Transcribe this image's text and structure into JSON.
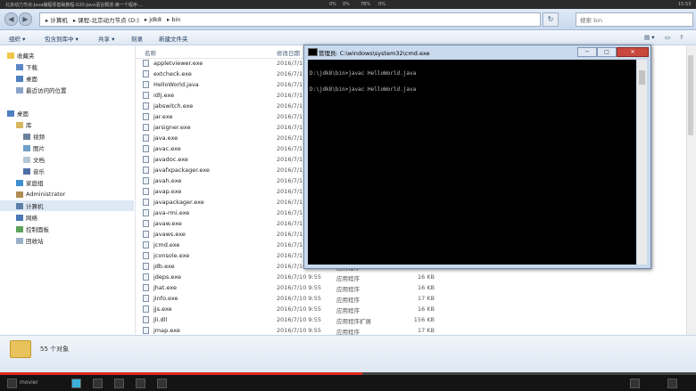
{
  "video_top": {
    "title": "北京动力节点-Java编程零基础教程-020-Java语言概述-第一个程序-...",
    "controls": [
      "0%",
      "0%",
      "78%",
      "0%"
    ],
    "time": "15:53"
  },
  "address": {
    "crumbs": [
      "▸ 计算机",
      "▸ 课程-北京动力节点 (D:)",
      "▸ jdk8",
      "▸ bin"
    ],
    "search_placeholder": "搜索 bin"
  },
  "toolbar": {
    "organize": "组织 ▾",
    "include": "包含到库中 ▾",
    "share": "共享 ▾",
    "burn": "刻录",
    "new_folder": "新建文件夹"
  },
  "nav": {
    "favorites": "收藏夹",
    "downloads": "下载",
    "desktop": "桌面",
    "recent": "最近访问的位置",
    "desktop2": "桌面",
    "library": "库",
    "videos": "视频",
    "pictures": "图片",
    "documents": "文档",
    "music": "音乐",
    "homegroup": "家庭组",
    "administrator": "Administrator",
    "computer": "计算机",
    "network": "网络",
    "control_panel": "控制面板",
    "recycle": "回收站"
  },
  "columns": {
    "name": "名称",
    "date": "修改日期"
  },
  "files": [
    {
      "name": "appletviewer.exe",
      "date": "2016/7/1",
      "type": "",
      "size": ""
    },
    {
      "name": "extcheck.exe",
      "date": "2016/7/1",
      "type": "",
      "size": ""
    },
    {
      "name": "HelloWorld.java",
      "date": "2016/7/1",
      "type": "",
      "size": ""
    },
    {
      "name": "idlj.exe",
      "date": "2016/7/1",
      "type": "",
      "size": ""
    },
    {
      "name": "jabswitch.exe",
      "date": "2016/7/1",
      "type": "",
      "size": ""
    },
    {
      "name": "jar.exe",
      "date": "2016/7/1",
      "type": "",
      "size": ""
    },
    {
      "name": "jarsigner.exe",
      "date": "2016/7/1",
      "type": "",
      "size": ""
    },
    {
      "name": "java.exe",
      "date": "2016/7/1",
      "type": "",
      "size": ""
    },
    {
      "name": "javac.exe",
      "date": "2016/7/1",
      "type": "",
      "size": ""
    },
    {
      "name": "javadoc.exe",
      "date": "2016/7/1",
      "type": "",
      "size": ""
    },
    {
      "name": "javafxpackager.exe",
      "date": "2016/7/1",
      "type": "",
      "size": ""
    },
    {
      "name": "javah.exe",
      "date": "2016/7/1",
      "type": "",
      "size": ""
    },
    {
      "name": "javap.exe",
      "date": "2016/7/1",
      "type": "",
      "size": ""
    },
    {
      "name": "javapackager.exe",
      "date": "2016/7/1",
      "type": "",
      "size": ""
    },
    {
      "name": "java-rmi.exe",
      "date": "2016/7/1",
      "type": "",
      "size": ""
    },
    {
      "name": "javaw.exe",
      "date": "2016/7/1",
      "type": "",
      "size": ""
    },
    {
      "name": "javaws.exe",
      "date": "2016/7/1",
      "type": "",
      "size": ""
    },
    {
      "name": "jcmd.exe",
      "date": "2016/7/1",
      "type": "",
      "size": ""
    },
    {
      "name": "jconsole.exe",
      "date": "2016/7/1",
      "type": "",
      "size": ""
    },
    {
      "name": "jdb.exe",
      "date": "2016/7/10 9:55",
      "type": "应用程序",
      "size": "16 KB"
    },
    {
      "name": "jdeps.exe",
      "date": "2016/7/10 9:55",
      "type": "应用程序",
      "size": "16 KB"
    },
    {
      "name": "jhat.exe",
      "date": "2016/7/10 9:55",
      "type": "应用程序",
      "size": "16 KB"
    },
    {
      "name": "jinfo.exe",
      "date": "2016/7/10 9:55",
      "type": "应用程序",
      "size": "17 KB"
    },
    {
      "name": "jjs.exe",
      "date": "2016/7/10 9:55",
      "type": "应用程序",
      "size": "16 KB"
    },
    {
      "name": "jli.dll",
      "date": "2016/7/10 9:55",
      "type": "应用程序扩展",
      "size": "156 KB"
    },
    {
      "name": "jmap.exe",
      "date": "2016/7/10 9:55",
      "type": "应用程序",
      "size": "17 KB"
    }
  ],
  "status": {
    "count": "55 个对象"
  },
  "cmd": {
    "title": "管理员: C:\\windows\\system32\\cmd.exe",
    "lines": [
      "D:\\jdk8\\bin>javac HelloWorld.java",
      "D:\\jdk8\\bin>javac HelloWorld.java"
    ]
  },
  "video_bottom": {
    "left_text": "movier",
    "progress": 0.52
  },
  "colors": {
    "accent": "#e0281c",
    "cmd_bg": "#000000"
  }
}
